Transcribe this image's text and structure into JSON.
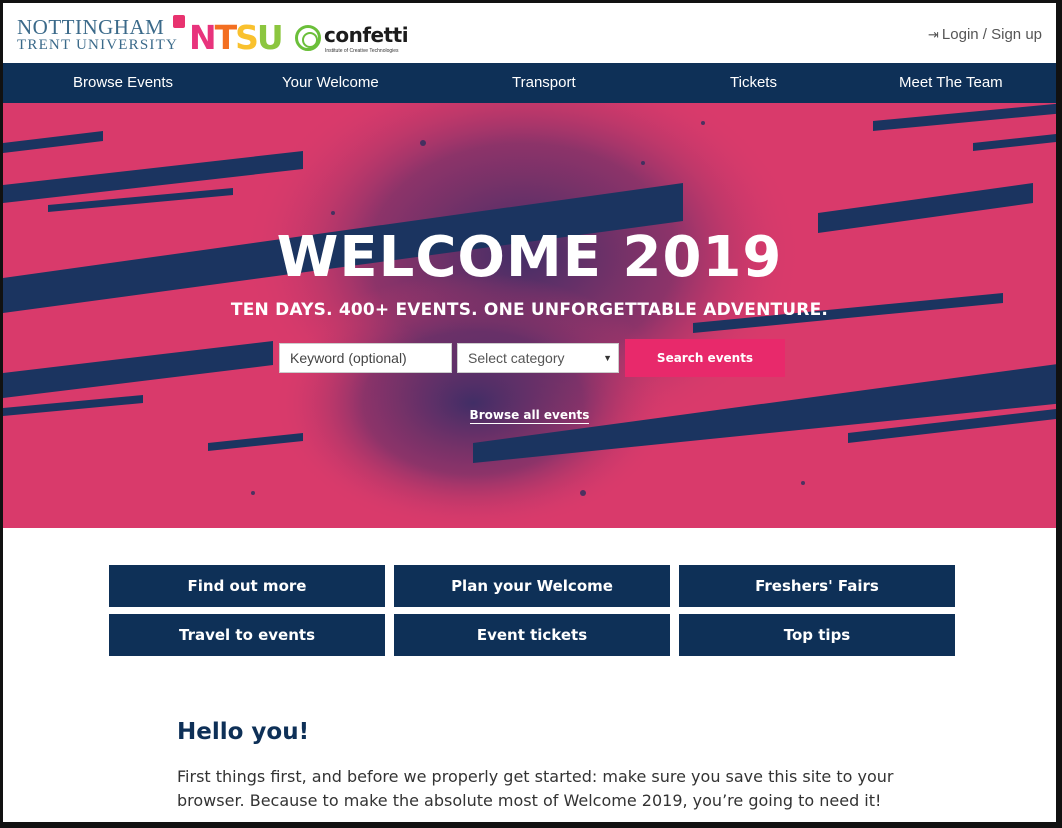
{
  "header": {
    "ntu_line1": "NOTTINGHAM",
    "ntu_line2": "TRENT UNIVERSITY",
    "ntsu_letters": [
      "N",
      "T",
      "S",
      "U"
    ],
    "confetti_name": "confetti",
    "confetti_tagline": "Institute of Creative Technologies",
    "login_icon": "sign-in-icon",
    "login_label": "Login / Sign up"
  },
  "nav": {
    "items": [
      {
        "label": "Browse Events"
      },
      {
        "label": "Your Welcome"
      },
      {
        "label": "Transport"
      },
      {
        "label": "Tickets"
      },
      {
        "label": "Meet The Team"
      }
    ]
  },
  "hero": {
    "title": "WELCOME 2019",
    "subtitle": "TEN DAYS. 400+ EVENTS. ONE UNFORGETTABLE ADVENTURE.",
    "keyword_placeholder": "Keyword (optional)",
    "category_value": "Select category",
    "search_label": "Search events",
    "browse_all_label": "Browse all events"
  },
  "quicklinks": {
    "items": [
      {
        "label": "Find out more"
      },
      {
        "label": "Plan your Welcome"
      },
      {
        "label": "Freshers' Fairs"
      },
      {
        "label": "Travel to events"
      },
      {
        "label": "Event tickets"
      },
      {
        "label": "Top tips"
      }
    ]
  },
  "intro": {
    "title": "Hello you!",
    "body": "First things first, and before we properly get started: make sure you save this site to your browser. Because to make the absolute most of Welcome 2019, you’re going to need it!"
  },
  "colors": {
    "navy": "#0e3057",
    "pink": "#d93a6b",
    "search_pink": "#e8296b"
  }
}
